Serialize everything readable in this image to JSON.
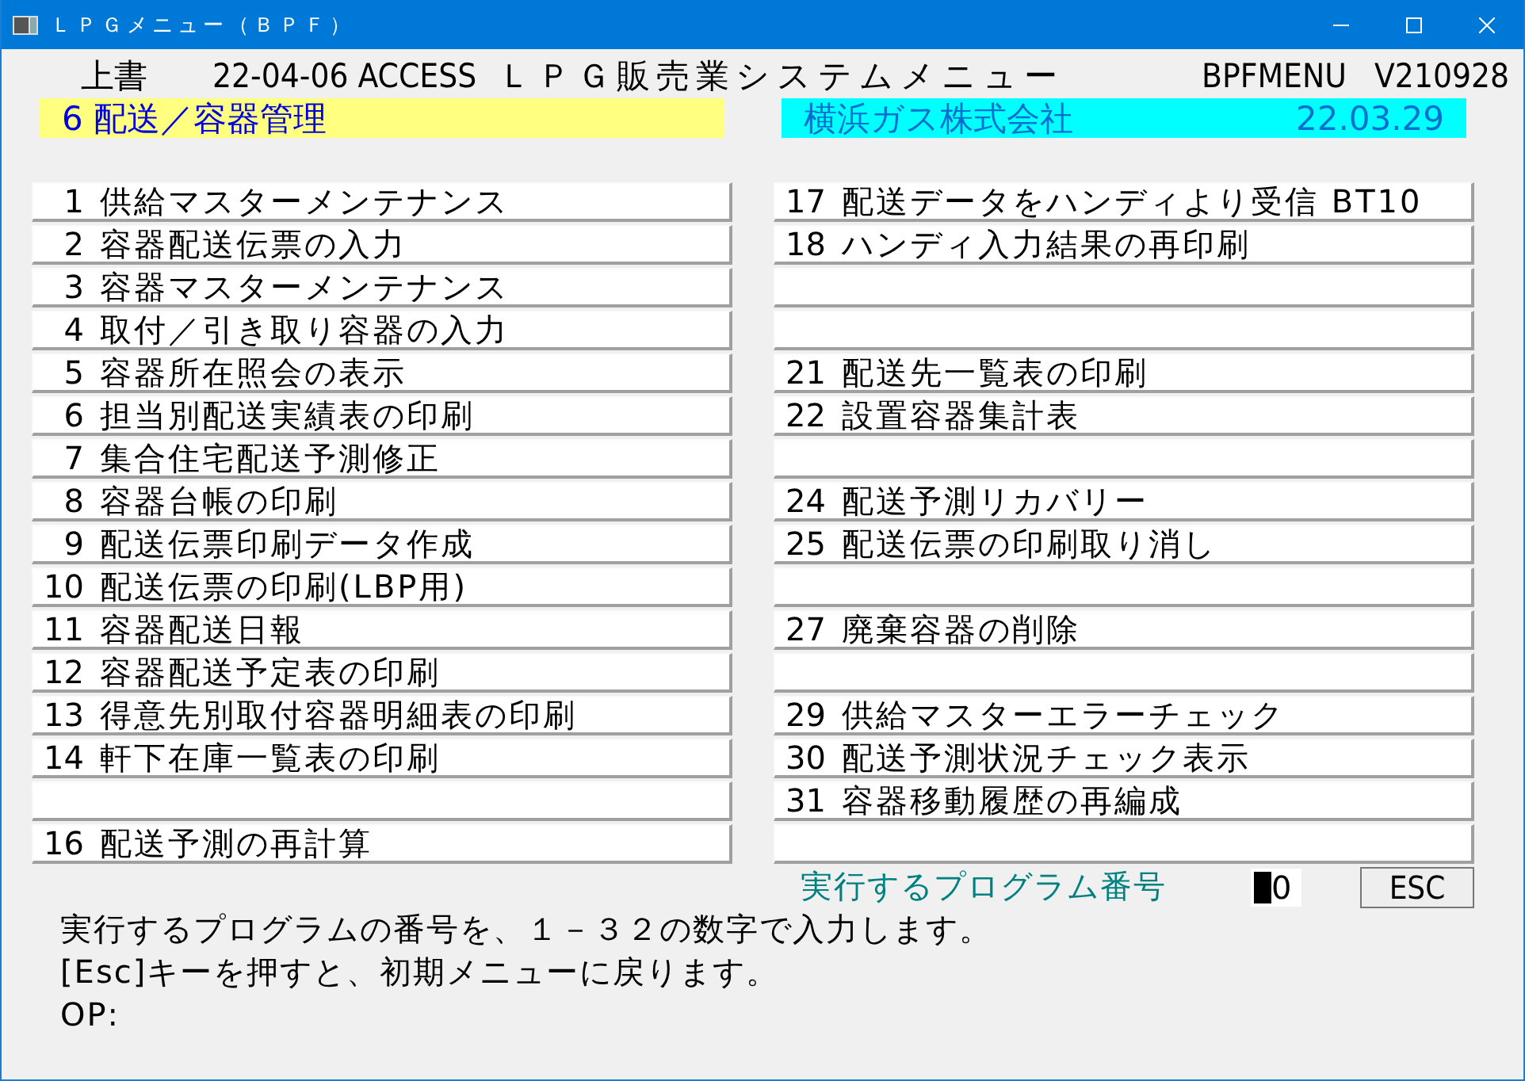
{
  "window": {
    "title": "ＬＰＧメニュー（ＢＰＦ）"
  },
  "header": {
    "mode": "上書",
    "date_user": "22-04-06 ACCESS",
    "system_title": "ＬＰＧ販売業システムメニュー",
    "program_id": "BPFMENU",
    "version": "V210928"
  },
  "category": {
    "label": "6 配送／容器管理"
  },
  "company": {
    "name": "横浜ガス株式会社",
    "date": "22.03.29"
  },
  "menu": {
    "left_column": [
      {
        "kind": "item",
        "number": "1",
        "label": "供給マスターメンテナンス"
      },
      {
        "kind": "item",
        "number": "2",
        "label": "容器配送伝票の入力"
      },
      {
        "kind": "item",
        "number": "3",
        "label": "容器マスターメンテナンス"
      },
      {
        "kind": "item",
        "number": "4",
        "label": "取付／引き取り容器の入力"
      },
      {
        "kind": "item",
        "number": "5",
        "label": "容器所在照会の表示"
      },
      {
        "kind": "item",
        "number": "6",
        "label": "担当別配送実績表の印刷"
      },
      {
        "kind": "item",
        "number": "7",
        "label": "集合住宅配送予測修正"
      },
      {
        "kind": "item",
        "number": "8",
        "label": "容器台帳の印刷"
      },
      {
        "kind": "item",
        "number": "9",
        "label": "配送伝票印刷データ作成"
      },
      {
        "kind": "item",
        "number": "10",
        "label": "配送伝票の印刷(LBP用)"
      },
      {
        "kind": "item",
        "number": "11",
        "label": "容器配送日報"
      },
      {
        "kind": "item",
        "number": "12",
        "label": "容器配送予定表の印刷"
      },
      {
        "kind": "item",
        "number": "13",
        "label": "得意先別取付容器明細表の印刷"
      },
      {
        "kind": "item",
        "number": "14",
        "label": "軒下在庫一覧表の印刷"
      },
      {
        "kind": "blank"
      },
      {
        "kind": "item",
        "number": "16",
        "label": "配送予測の再計算"
      }
    ],
    "right_column": [
      {
        "kind": "item",
        "number": "17",
        "label": "配送データをハンディより受信 BT10"
      },
      {
        "kind": "item",
        "number": "18",
        "label": "ハンディ入力結果の再印刷"
      },
      {
        "kind": "blank"
      },
      {
        "kind": "blank"
      },
      {
        "kind": "item",
        "number": "21",
        "label": "配送先一覧表の印刷"
      },
      {
        "kind": "item",
        "number": "22",
        "label": "設置容器集計表"
      },
      {
        "kind": "blank"
      },
      {
        "kind": "item",
        "number": "24",
        "label": "配送予測リカバリー"
      },
      {
        "kind": "item",
        "number": "25",
        "label": "配送伝票の印刷取り消し"
      },
      {
        "kind": "blank"
      },
      {
        "kind": "item",
        "number": "27",
        "label": "廃棄容器の削除"
      },
      {
        "kind": "blank"
      },
      {
        "kind": "item",
        "number": "29",
        "label": "供給マスターエラーチェック"
      },
      {
        "kind": "item",
        "number": "30",
        "label": "配送予測状況チェック表示"
      },
      {
        "kind": "item",
        "number": "31",
        "label": "容器移動履歴の再編成"
      },
      {
        "kind": "blank"
      }
    ]
  },
  "prompt": {
    "label": "実行するプログラム番号",
    "value": "0",
    "escape_button": "ESC"
  },
  "messages": [
    "実行するプログラムの番号を、１－３２の数字で入力します。",
    "[Esc]キーを押すと、初期メニューに戻ります。",
    "OP:"
  ]
}
